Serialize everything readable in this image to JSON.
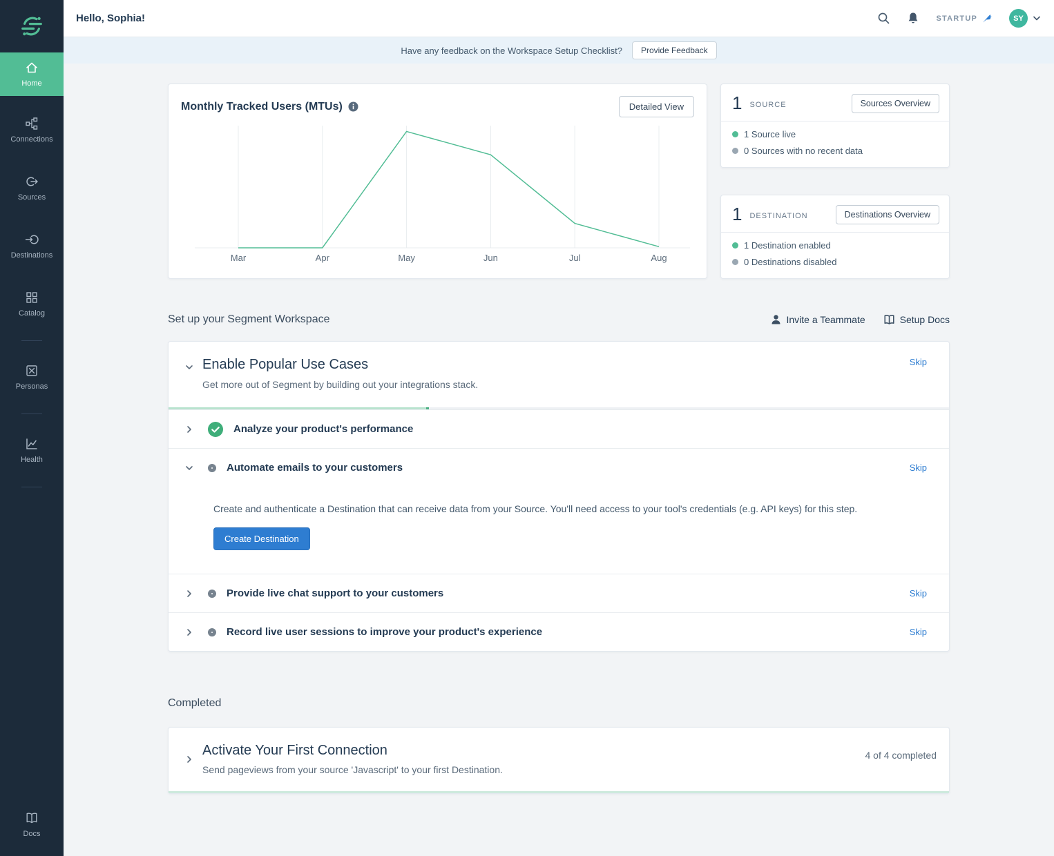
{
  "colors": {
    "accent_green": "#52bd95",
    "accent_blue": "#2e7dd1",
    "sidebar_bg": "#1c2b3a"
  },
  "header": {
    "greeting": "Hello, Sophia!",
    "plan_label": "STARTUP",
    "avatar_initials": "SY"
  },
  "banner": {
    "text": "Have any feedback on the Workspace Setup Checklist?",
    "button": "Provide Feedback"
  },
  "sidebar": {
    "items": [
      {
        "label": "Home",
        "icon": "home-icon",
        "active": true
      },
      {
        "label": "Connections",
        "icon": "connections-icon",
        "active": false
      },
      {
        "label": "Sources",
        "icon": "sources-icon",
        "active": false
      },
      {
        "label": "Destinations",
        "icon": "destinations-icon",
        "active": false
      },
      {
        "label": "Catalog",
        "icon": "catalog-icon",
        "active": false
      },
      {
        "label": "Personas",
        "icon": "personas-icon",
        "active": false
      },
      {
        "label": "Health",
        "icon": "health-icon",
        "active": false
      }
    ],
    "bottom_item": {
      "label": "Docs",
      "icon": "docs-icon"
    }
  },
  "chart_card": {
    "title": "Monthly Tracked Users (MTUs)",
    "button": "Detailed View"
  },
  "chart_data": {
    "type": "line",
    "title": "Monthly Tracked Users (MTUs)",
    "x": [
      "Mar",
      "Apr",
      "May",
      "Jun",
      "Jul",
      "Aug"
    ],
    "series": [
      {
        "name": "MTUs",
        "values": [
          0,
          0,
          100,
          80,
          21,
          1
        ]
      }
    ],
    "xlabel": "",
    "ylabel": "",
    "ylim": [
      0,
      105
    ],
    "grid": "vertical",
    "legend": "none",
    "line_color": "#52bd95"
  },
  "sources_card": {
    "count": "1",
    "label": "SOURCE",
    "button": "Sources Overview",
    "stats": [
      {
        "text": "1 Source live",
        "dot_color": "#52bd95"
      },
      {
        "text": "0 Sources with no recent data",
        "dot_color": "#9aa7b2"
      }
    ]
  },
  "destinations_card": {
    "count": "1",
    "label": "DESTINATION",
    "button": "Destinations Overview",
    "stats": [
      {
        "text": "1 Destination enabled",
        "dot_color": "#52bd95"
      },
      {
        "text": "0 Destinations disabled",
        "dot_color": "#9aa7b2"
      }
    ]
  },
  "setup_section": {
    "title": "Set up your Segment Workspace",
    "invite_link": "Invite a Teammate",
    "docs_link": "Setup Docs",
    "header_card": {
      "title": "Enable Popular Use Cases",
      "subtitle": "Get more out of Segment by building out your integrations stack.",
      "skip": "Skip",
      "progress_percent": 33
    },
    "tasks": [
      {
        "title": "Analyze your product's performance",
        "state": "done"
      },
      {
        "title": "Automate emails to your customers",
        "state": "expanded",
        "skip": "Skip",
        "body": "Create and authenticate a Destination that can receive data from your Source. You'll need access to your tool's credentials (e.g. API keys) for this step.",
        "button": "Create Destination"
      },
      {
        "title": "Provide live chat support to your customers",
        "state": "todo",
        "skip": "Skip"
      },
      {
        "title": "Record live user sessions to improve your product's experience",
        "state": "todo",
        "skip": "Skip"
      }
    ]
  },
  "completed_section": {
    "title": "Completed",
    "card": {
      "title": "Activate Your First Connection",
      "subtitle": "Send pageviews from your source 'Javascript' to your first Destination.",
      "status": "4 of 4 completed",
      "progress_percent": 100
    }
  }
}
